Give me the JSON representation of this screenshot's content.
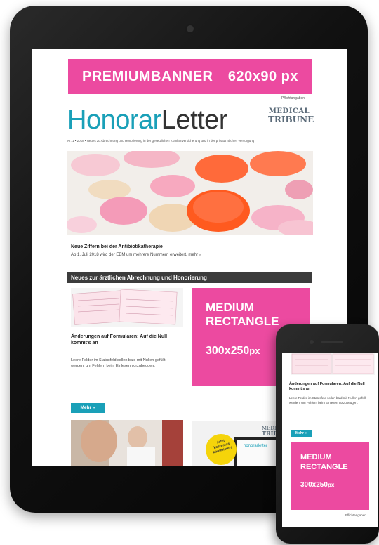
{
  "tablet": {
    "banner": {
      "label": "PREMIUMBANNER",
      "size": "620x90 px"
    },
    "required_note": "Pflichtangaben",
    "logo": {
      "part1": "Honorar",
      "part2": "Letter"
    },
    "publisher": {
      "line1": "MEDICAL",
      "line2": "TRIBUNE"
    },
    "subline": "Nr. 1 • 2018 • Neues zu Abrechnung und Honorierung in der gesetzlichen Krankenversicherung und in der privatärztlichen Versorgung",
    "article1": {
      "title": "Neue Ziffern bei der Antibiotikatherapie",
      "teaser": "Ab 1. Juli 2018 wird der EBM um mehrere Nummern erweitert. mehr »"
    },
    "section_title": "Neues zur ärztlichen Abrechnung und Honorierung",
    "article2": {
      "title": "Änderungen auf Formularen: Auf die Null kommt's an",
      "teaser": "Leere Felder im Statusfeld sollen bald mit Nullen gefüllt werden, um Fehlern beim Einlesen vorzubeugen."
    },
    "more_button": "Mehr »",
    "ad_rect": {
      "line1": "MEDIUM",
      "line2": "RECTANGLE",
      "size_num": "300x250",
      "size_unit": "px"
    },
    "promo": {
      "sticker_line1": "Jetzt",
      "sticker_line2": "kostenlos",
      "sticker_line3": "abonnieren!",
      "mini_logo": "honorarletter"
    }
  },
  "phone": {
    "article_title": "Änderungen auf Formularen: Auf die Null kommt's an",
    "article_teaser": "Leere Felder im Statusfeld sollen bald mit Nullen gefüllt werden, um Fehlern beim Einlesen vorzubeugen.",
    "more_button": "Mehr »",
    "ad_rect": {
      "line1": "MEDIUM",
      "line2": "RECTANGLE",
      "size_num": "300x250",
      "size_unit": "px"
    },
    "required_note": "Pflichtangaben"
  },
  "colors": {
    "accent_pink": "#ec4aa0",
    "teal": "#1aa0b8",
    "section_bar": "#3c3c3c"
  }
}
